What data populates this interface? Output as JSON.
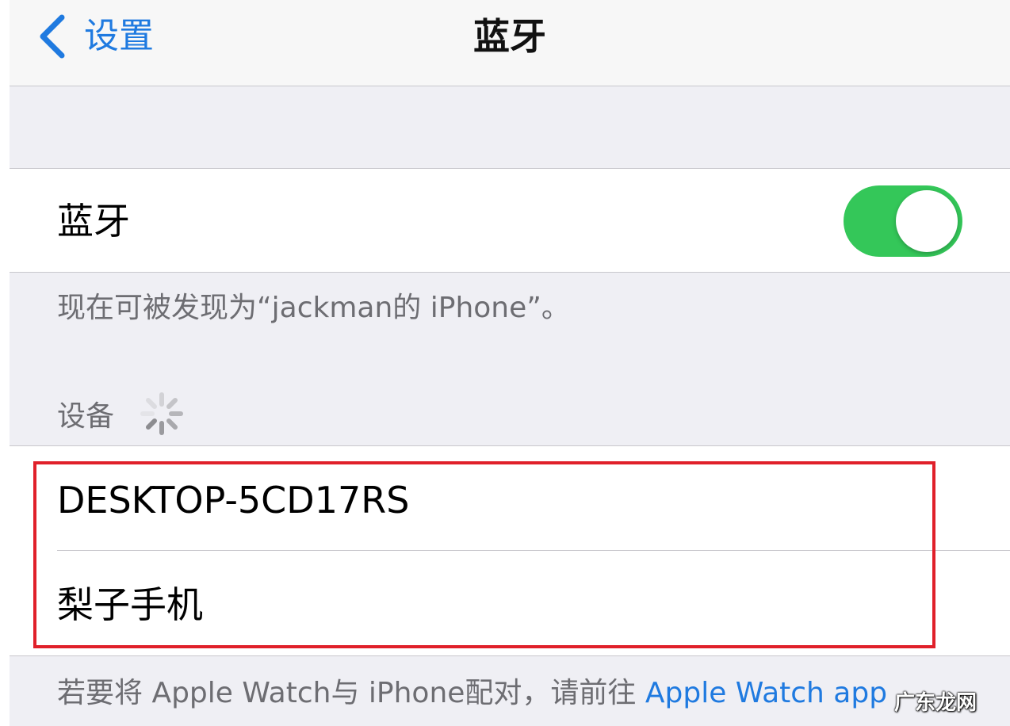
{
  "nav": {
    "back_label": "设置",
    "title": "蓝牙"
  },
  "bluetooth": {
    "toggle_label": "蓝牙",
    "enabled": true,
    "discoverable_note": "现在可被发现为“jackman的 iPhone”。"
  },
  "devices_section": {
    "header": "设备",
    "items": [
      {
        "name": "DESKTOP-5CD17RS"
      },
      {
        "name": "梨子手机"
      }
    ]
  },
  "footer": {
    "text": "若要将 Apple Watch与 iPhone配对，请前往 ",
    "link_label": "Apple Watch app"
  },
  "watermark": "广东龙网",
  "colors": {
    "accent": "#1f7ae0",
    "switch_on": "#34c759",
    "highlight": "#e0202a",
    "secondary_text": "#6d6d72",
    "background": "#efeff4"
  },
  "icons": {
    "back": "chevron-left-icon",
    "loading": "activity-spinner-icon"
  }
}
